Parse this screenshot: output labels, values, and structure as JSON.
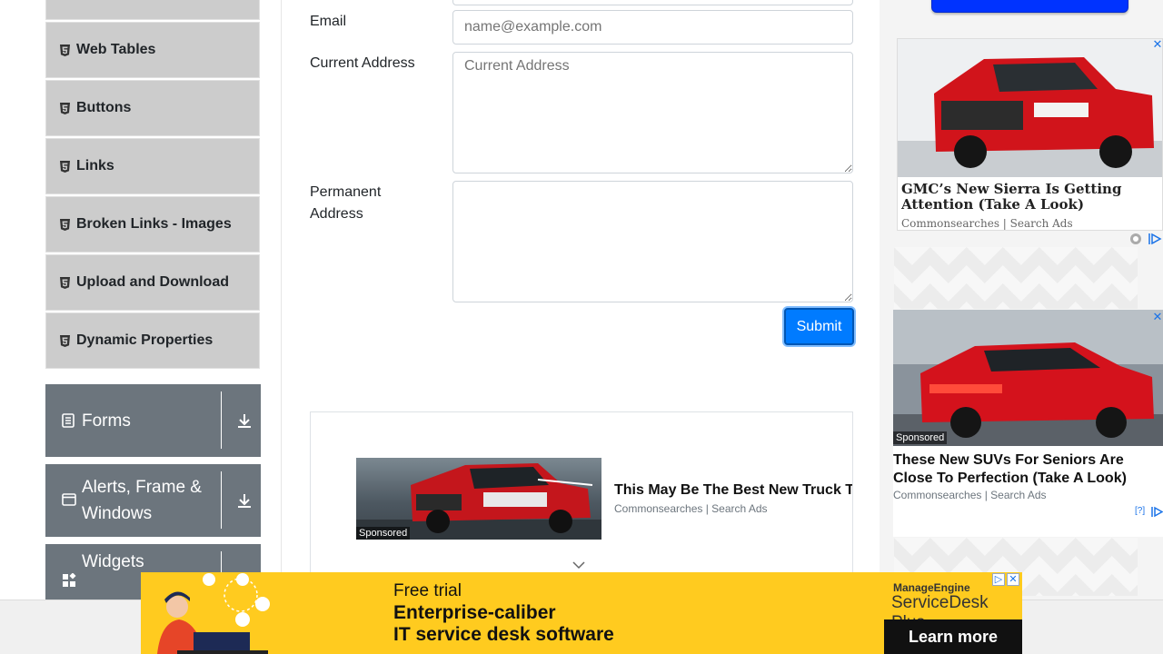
{
  "sidebar": {
    "items": [
      {
        "label": "Web Tables"
      },
      {
        "label": "Buttons"
      },
      {
        "label": "Links"
      },
      {
        "label": "Broken Links - Images"
      },
      {
        "label": "Upload and Download"
      },
      {
        "label": "Dynamic Properties"
      }
    ],
    "groups": [
      {
        "label": "Forms"
      },
      {
        "label": "Alerts, Frame & Windows"
      },
      {
        "label": "Widgets"
      }
    ]
  },
  "form": {
    "email_label": "Email",
    "email_placeholder": "name@example.com",
    "current_address_label": "Current Address",
    "current_address_placeholder": "Current Address",
    "permanent_address_label": "Permanent Address",
    "submit_label": "Submit"
  },
  "center_ad": {
    "sponsored": "Sponsored",
    "headline": "This May Be The Best New Truck This Year",
    "source": "Commonsearches | Search Ads"
  },
  "right_ads": [
    {
      "title": "GMC’s New Sierra Is Getting Attention (Take A Look)",
      "source": "Commonsearches | Search Ads"
    },
    {
      "sponsored": "Sponsored",
      "title": "These New SUVs For Seniors Are Close To Perfection (Take A Look)",
      "source": "Commonsearches | Search Ads",
      "help": "[?]"
    }
  ],
  "banner": {
    "line1": "Free trial",
    "line2": "Enterprise-caliber",
    "line3": "IT service desk software",
    "brand": "ManageEngine",
    "product": "ServiceDesk Plus",
    "cta": "Learn more"
  },
  "colors": {
    "primary": "#007bff",
    "sidebar_group": "#6c757d",
    "sidebar_item": "#cccccc",
    "banner": "#ffcb1f"
  }
}
